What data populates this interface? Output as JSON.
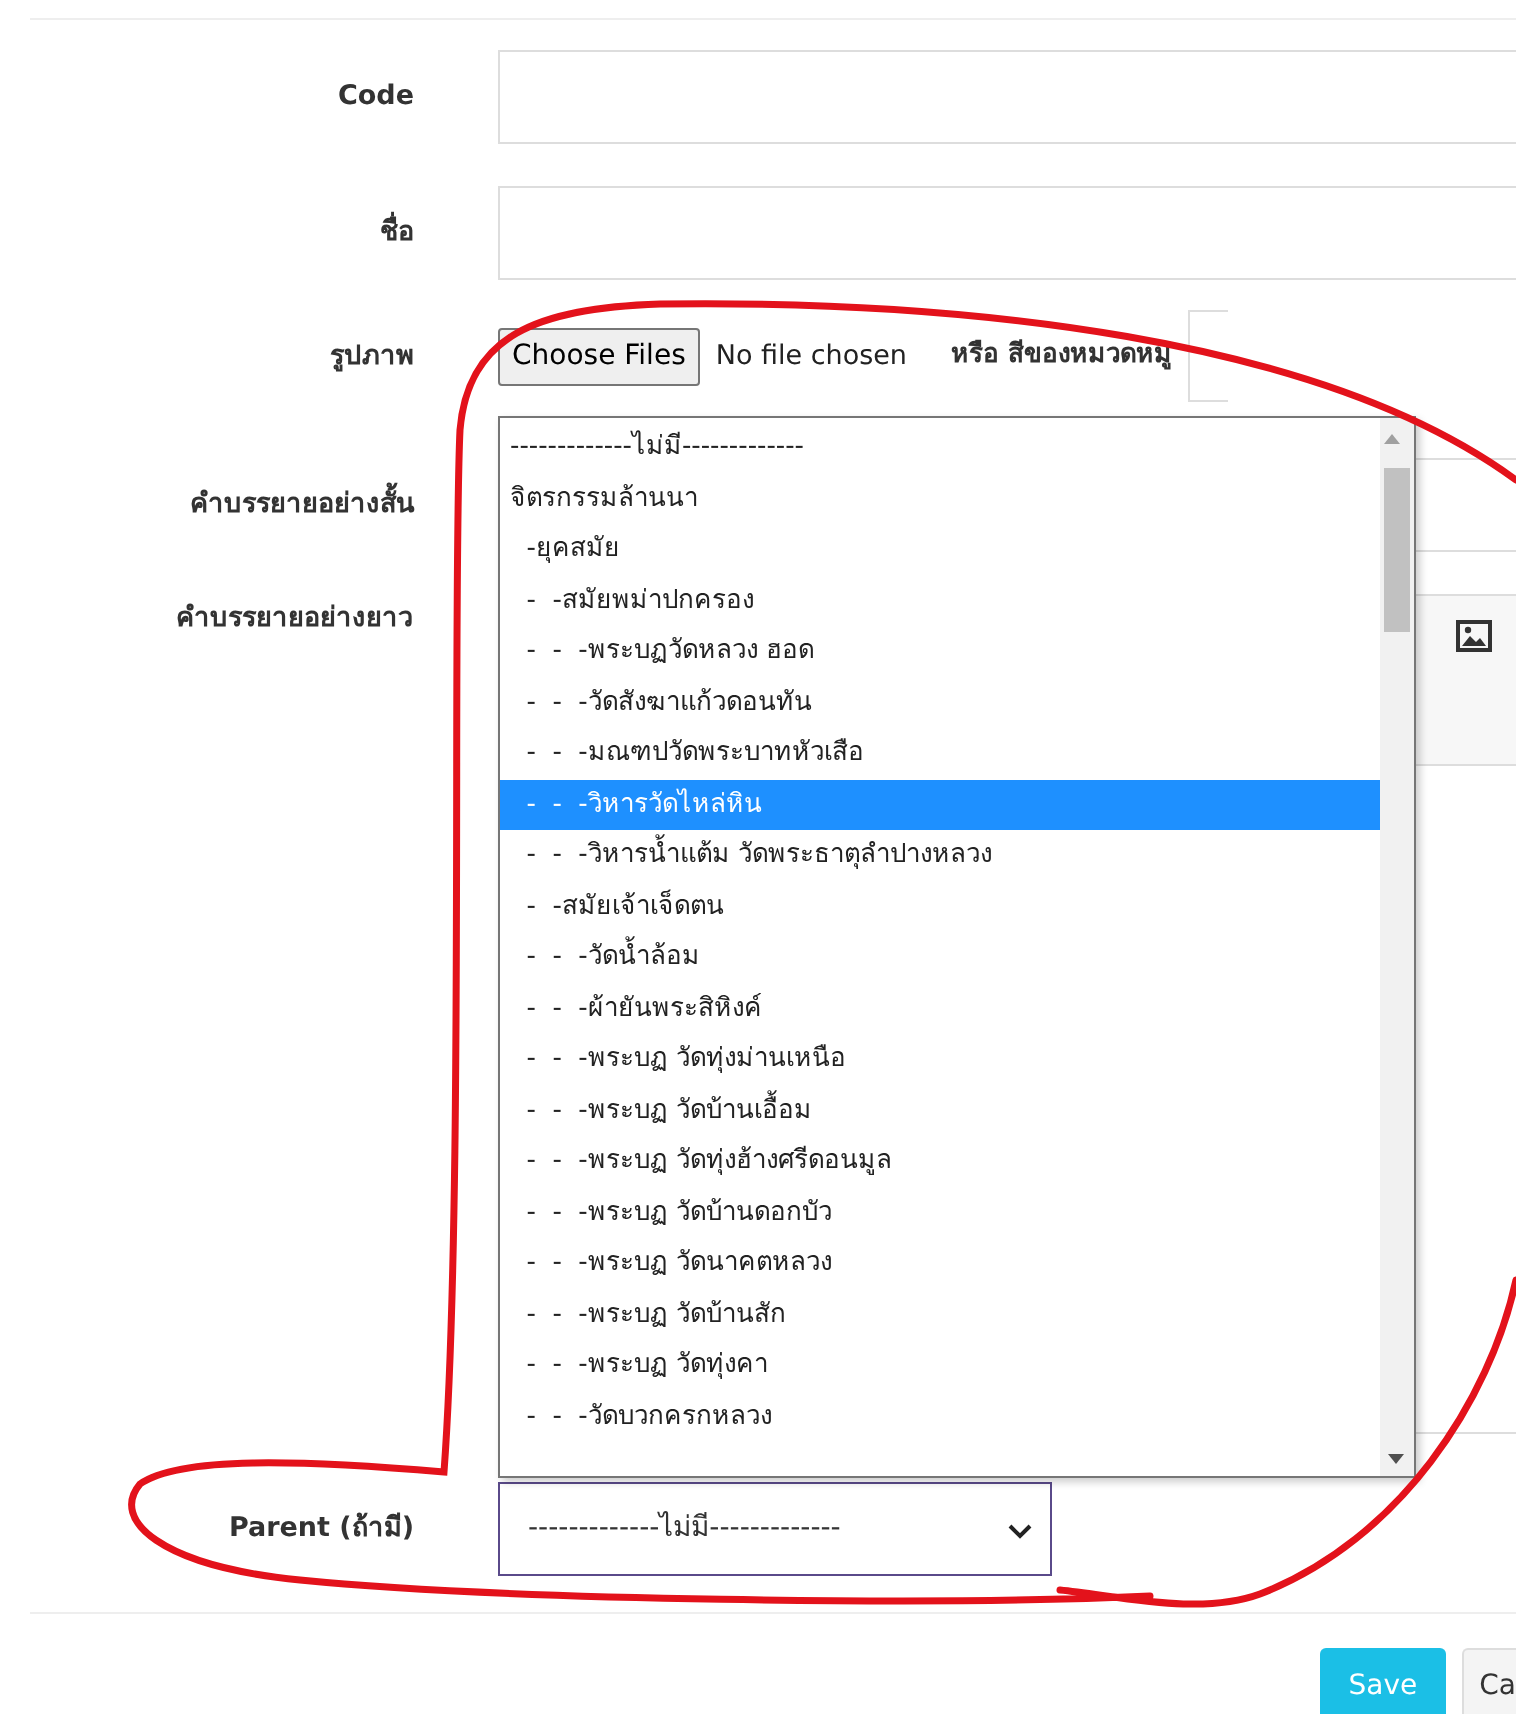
{
  "fields": [
    {
      "label": "Code",
      "kind": "text"
    },
    {
      "label": "ชื่อ",
      "kind": "text"
    },
    {
      "label": "รูปภาพ",
      "kind": "file",
      "button": "Choose Files",
      "status": "No file chosen",
      "extra_label": "หรือ สีของหมวดหมู่"
    },
    {
      "label": "คำบรรยายอย่างสั้น",
      "kind": "text"
    },
    {
      "label": "คำบรรยายอย่างยาว",
      "kind": "editor"
    },
    {
      "label": "Parent (ถ้ามี)",
      "kind": "select",
      "value": "-------------ไม่มี-------------"
    }
  ],
  "dropdown": {
    "options": [
      {
        "label": "-------------ไม่มี-------------",
        "selected": false
      },
      {
        "label": "จิตรกรรมล้านนา",
        "selected": false
      },
      {
        "label": "  -ยุคสมัย",
        "selected": false
      },
      {
        "label": "  -  -สมัยพม่าปกครอง",
        "selected": false
      },
      {
        "label": "  -  -  -พระบฏวัดหลวง ฮอด",
        "selected": false
      },
      {
        "label": "  -  -  -วัดสังฆาแก้วดอนทัน",
        "selected": false
      },
      {
        "label": "  -  -  -มณฑปวัดพระบาทหัวเสือ",
        "selected": false
      },
      {
        "label": "  -  -  -วิหารวัดไหล่หิน",
        "selected": true
      },
      {
        "label": "  -  -  -วิหารน้ำแต้ม วัดพระธาตุลำปางหลวง",
        "selected": false
      },
      {
        "label": "  -  -สมัยเจ้าเจ็ดตน",
        "selected": false
      },
      {
        "label": "  -  -  -วัดน้ำล้อม",
        "selected": false
      },
      {
        "label": "  -  -  -ผ้ายันพระสิหิงค์",
        "selected": false
      },
      {
        "label": "  -  -  -พระบฏ วัดทุ่งม่านเหนือ",
        "selected": false
      },
      {
        "label": "  -  -  -พระบฏ วัดบ้านเอื้อม",
        "selected": false
      },
      {
        "label": "  -  -  -พระบฏ วัดทุ่งฮ้างศรีดอนมูล",
        "selected": false
      },
      {
        "label": "  -  -  -พระบฏ วัดบ้านดอกบัว",
        "selected": false
      },
      {
        "label": "  -  -  -พระบฏ วัดนาคตหลวง",
        "selected": false
      },
      {
        "label": "  -  -  -พระบฏ วัดบ้านสัก",
        "selected": false
      },
      {
        "label": "  -  -  -พระบฏ วัดทุ่งคา",
        "selected": false
      },
      {
        "label": "  -  -  -วัดบวกครกหลวง",
        "selected": false
      }
    ]
  },
  "buttons": [
    {
      "label": "Save",
      "kind": "primary"
    },
    {
      "label": "Ca",
      "kind": "secondary"
    }
  ]
}
